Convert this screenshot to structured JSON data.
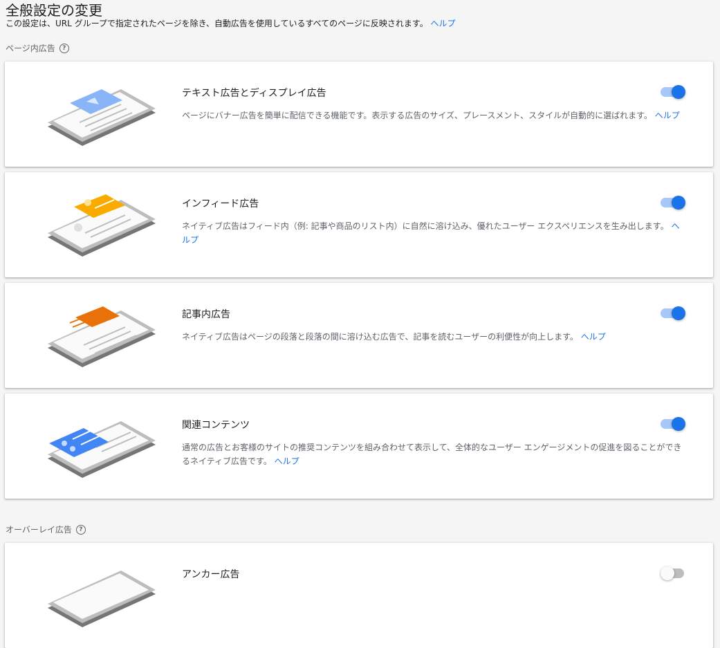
{
  "header": {
    "title": "全般設定の変更",
    "subtitle": "この設定は、URL グループで指定されたページを除き、自動広告を使用しているすべてのページに反映されます。",
    "help_link": "ヘルプ"
  },
  "sections": {
    "in_page": {
      "label": "ページ内広告",
      "help_icon": "help-circle-icon"
    },
    "overlay": {
      "label": "オーバーレイ広告",
      "help_icon": "help-circle-icon"
    }
  },
  "cards": [
    {
      "title": "テキスト広告とディスプレイ広告",
      "description": "ページにバナー広告を簡単に配信できる機能です。表示する広告のサイズ、プレースメント、スタイルが自動的に選ばれます。",
      "help_link": "ヘルプ",
      "enabled": true,
      "accent_color": "#8ab4f8"
    },
    {
      "title": "インフィード広告",
      "description": "ネイティブ広告はフィード内（例: 記事や商品のリスト内）に自然に溶け込み、優れたユーザー エクスペリエンスを生み出します。",
      "help_link": "ヘルプ",
      "enabled": true,
      "accent_color": "#f9ab00"
    },
    {
      "title": "記事内広告",
      "description": "ネイティブ広告はページの段落と段落の間に溶け込む広告で、記事を読むユーザーの利便性が向上します。",
      "help_link": "ヘルプ",
      "enabled": true,
      "accent_color": "#e8710a"
    },
    {
      "title": "関連コンテンツ",
      "description": "通常の広告とお客様のサイトの推奨コンテンツを組み合わせて表示して、全体的なユーザー エンゲージメントの促進を図ることができるネイティブ広告です。",
      "help_link": "ヘルプ",
      "enabled": true,
      "accent_color": "#4285f4"
    },
    {
      "title": "アンカー広告",
      "enabled": false
    }
  ],
  "colors": {
    "toggle_on": "#1a73e8",
    "toggle_track_on": "#a8c7fa",
    "link": "#1a73e8"
  }
}
